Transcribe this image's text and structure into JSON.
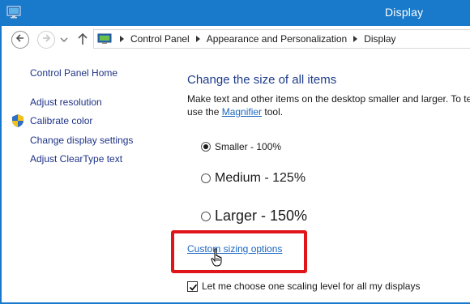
{
  "window": {
    "title": "Display",
    "accent_color": "#1979ca",
    "app_icon": "monitor-icon"
  },
  "nav": {
    "back_icon": "back-arrow-icon",
    "forward_icon": "forward-arrow-icon",
    "recent_icon": "chevron-down-icon",
    "up_icon": "up-arrow-icon",
    "breadcrumb": [
      "Control Panel",
      "Appearance and Personalization",
      "Display"
    ]
  },
  "sidebar": {
    "home": "Control Panel Home",
    "items": [
      {
        "label": "Adjust resolution"
      },
      {
        "label": "Calibrate color",
        "icon": "shield-icon"
      },
      {
        "label": "Change display settings"
      },
      {
        "label": "Adjust ClearType text"
      }
    ]
  },
  "main": {
    "heading": "Change the size of all items",
    "description_line1": "Make text and other items on the desktop smaller and larger. To te",
    "description_line2_prefix": "use the ",
    "magnifier_link": "Magnifier",
    "description_line2_suffix": " tool.",
    "options": [
      {
        "label": "Smaller - 100%",
        "selected": true
      },
      {
        "label": "Medium - 125%",
        "selected": false
      },
      {
        "label": "Larger - 150%",
        "selected": false
      }
    ],
    "custom_sizing_link": "Custom sizing options",
    "highlight_color": "#e0151a",
    "scaling_checkbox": {
      "label": "Let me choose one scaling level for all my displays",
      "checked": true
    }
  }
}
